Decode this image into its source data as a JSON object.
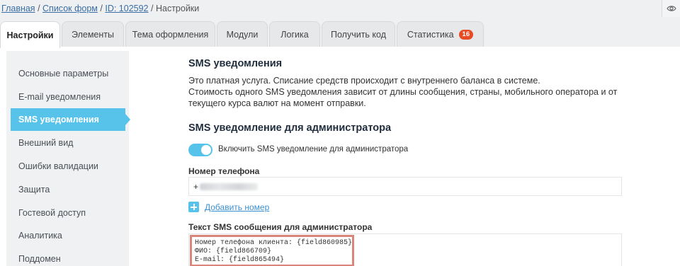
{
  "breadcrumb": {
    "home": "Главная",
    "forms": "Список форм",
    "id": "ID: 102592",
    "current": "Настройки",
    "separator": "/"
  },
  "tabs": [
    {
      "label": "Настройки",
      "active": true
    },
    {
      "label": "Элементы"
    },
    {
      "label": "Тема оформления"
    },
    {
      "label": "Модули"
    },
    {
      "label": "Логика"
    },
    {
      "label": "Получить код"
    },
    {
      "label": "Статистика",
      "badge": "16"
    }
  ],
  "sidebar": {
    "items": [
      {
        "label": "Основные параметры"
      },
      {
        "label": "E-mail уведомления"
      },
      {
        "label": "SMS уведомления",
        "active": true
      },
      {
        "label": "Внешний вид"
      },
      {
        "label": "Ошибки валидации"
      },
      {
        "label": "Защита"
      },
      {
        "label": "Гостевой доступ"
      },
      {
        "label": "Аналитика"
      },
      {
        "label": "Поддомен"
      }
    ]
  },
  "main": {
    "title": "SMS уведомления",
    "description_1": "Это платная услуга. Списание средств происходит с внутреннего баланса в системе.",
    "description_2": "Стоимость одного SMS уведомления зависит от длины сообщения, страны, мобильного оператора и от текущего курса валют на момент отправки.",
    "admin_section_title": "SMS уведомление для администратора",
    "toggle_label": "Включить SMS уведомление для администратора",
    "toggle_on": true,
    "phone_label": "Номер телефона",
    "phone_prefix": "+",
    "add_number_label": "Добавить номер",
    "sms_text_label": "Текст SMS сообщения для администратора",
    "sms_text_lines": [
      "Номер телефона клиента: {field860985}",
      "ФИО: {field866709}",
      "E-mail: {field865494}"
    ]
  },
  "colors": {
    "accent": "#57c3ea",
    "badge": "#e74c25",
    "highlight_border": "#d9857a",
    "link": "#3a6ea5"
  },
  "icons": {
    "eye": "eye-icon",
    "add": "plus-icon"
  }
}
